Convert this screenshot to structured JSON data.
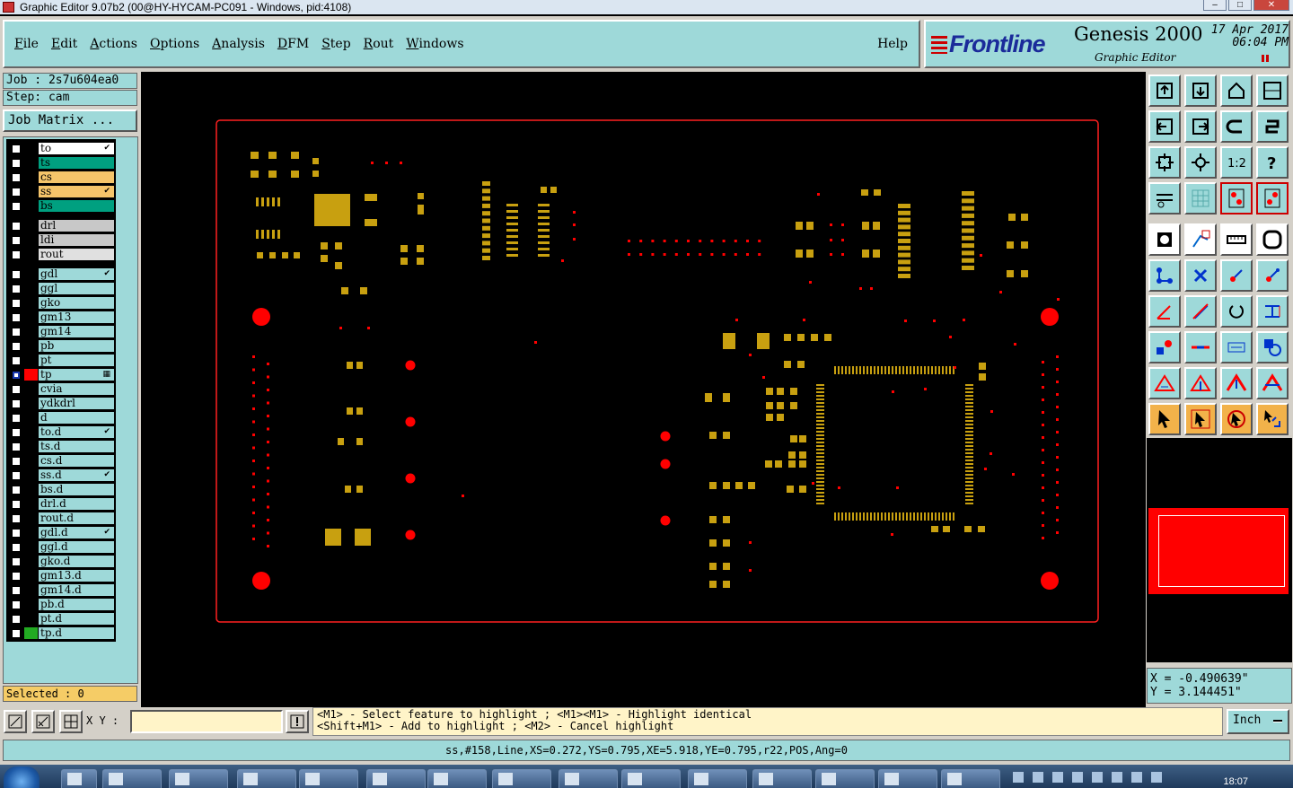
{
  "title": "Graphic Editor 9.07b2 (00@HY-HYCAM-PC091 - Windows, pid:4108)",
  "menu": [
    "File",
    "Edit",
    "Actions",
    "Options",
    "Analysis",
    "DFM",
    "Step",
    "Rout",
    "Windows"
  ],
  "help": "Help",
  "brand": {
    "logo": "Frontline",
    "product": "Genesis 2000",
    "subtitle": "Graphic Editor",
    "date": "17 Apr 2017",
    "time": "06:04 PM"
  },
  "job": {
    "job": "Job : 2s7u604ea0",
    "step": "Step: cam",
    "matrix": "Job Matrix ..."
  },
  "layers": [
    {
      "name": "to",
      "color": "#ffffff",
      "mark": "✔"
    },
    {
      "name": "ts",
      "color": "#00a080",
      "mark": ""
    },
    {
      "name": "cs",
      "color": "#f5c46a",
      "mark": ""
    },
    {
      "name": "ss",
      "color": "#f5c46a",
      "mark": "✔"
    },
    {
      "name": "bs",
      "color": "#00a080",
      "mark": ""
    },
    {
      "name": "drl",
      "color": "#c8c8c8",
      "mark": ""
    },
    {
      "name": "ldi",
      "color": "#c8c8c8",
      "mark": ""
    },
    {
      "name": "rout",
      "color": "#e0e0e0",
      "mark": ""
    },
    {
      "name": "gdl",
      "color": "#9ed9d9",
      "mark": "✔"
    },
    {
      "name": "ggl",
      "color": "#9ed9d9",
      "mark": ""
    },
    {
      "name": "gko",
      "color": "#9ed9d9",
      "mark": ""
    },
    {
      "name": "gm13",
      "color": "#9ed9d9",
      "mark": ""
    },
    {
      "name": "gm14",
      "color": "#9ed9d9",
      "mark": ""
    },
    {
      "name": "pb",
      "color": "#9ed9d9",
      "mark": ""
    },
    {
      "name": "pt",
      "color": "#9ed9d9",
      "mark": ""
    },
    {
      "name": "tp",
      "color": "#9ed9d9",
      "mark": "▦"
    },
    {
      "name": "cvia",
      "color": "#9ed9d9",
      "mark": ""
    },
    {
      "name": "ydkdrl",
      "color": "#9ed9d9",
      "mark": ""
    },
    {
      "name": "d",
      "color": "#9ed9d9",
      "mark": ""
    },
    {
      "name": "to.d",
      "color": "#9ed9d9",
      "mark": "✔"
    },
    {
      "name": "ts.d",
      "color": "#9ed9d9",
      "mark": ""
    },
    {
      "name": "cs.d",
      "color": "#9ed9d9",
      "mark": ""
    },
    {
      "name": "ss.d",
      "color": "#9ed9d9",
      "mark": "✔"
    },
    {
      "name": "bs.d",
      "color": "#9ed9d9",
      "mark": ""
    },
    {
      "name": "drl.d",
      "color": "#9ed9d9",
      "mark": ""
    },
    {
      "name": "rout.d",
      "color": "#9ed9d9",
      "mark": ""
    },
    {
      "name": "gdl.d",
      "color": "#9ed9d9",
      "mark": "✔"
    },
    {
      "name": "ggl.d",
      "color": "#9ed9d9",
      "mark": ""
    },
    {
      "name": "gko.d",
      "color": "#9ed9d9",
      "mark": ""
    },
    {
      "name": "gm13.d",
      "color": "#9ed9d9",
      "mark": ""
    },
    {
      "name": "gm14.d",
      "color": "#9ed9d9",
      "mark": ""
    },
    {
      "name": "pb.d",
      "color": "#9ed9d9",
      "mark": ""
    },
    {
      "name": "pt.d",
      "color": "#9ed9d9",
      "mark": ""
    },
    {
      "name": "tp.d",
      "color": "#9ed9d9",
      "mark": ""
    }
  ],
  "work_layer_colors": {
    "tp": "#ff0000",
    "tp.d": "#22aa22"
  },
  "selected": "Selected : 0",
  "coords": {
    "x": "X = -0.490639\"",
    "y": "Y = 3.144451\""
  },
  "xy_label": "X Y :",
  "xy_value": "",
  "messages": [
    "<M1> - Select feature to highlight ; <M1><M1> - Highlight identical",
    "<Shift+M1> - Add to highlight ; <M2> - Cancel highlight"
  ],
  "units": "Inch",
  "status": "ss,#158,Line,XS=0.272,YS=0.795,XE=5.918,YE=0.795,r22,POS,Ang=0",
  "clock": "18:07",
  "colors": {
    "pad": "#c8a010",
    "drill": "#ff0000",
    "outline": "#ff2020",
    "panel": "#9ed9d9"
  },
  "tools": [
    "save-icon",
    "open-icon",
    "home-icon",
    "window-icon",
    "move-left-icon",
    "move-right-icon",
    "undo-icon",
    "redo-icon",
    "zoom-fit-icon",
    "zoom-center-icon",
    "scale-1to2-icon",
    "help-icon",
    "settings-icon",
    "grid-icon",
    "layers-icon",
    "layers-alt-icon",
    "snap-icon",
    "edit-shape-icon",
    "ruler-icon",
    "circle-icon",
    "connect-icon",
    "cross-icon",
    "point-icon",
    "point-alt-icon",
    "line-icon",
    "diag-line-icon",
    "arc-icon",
    "track-icon",
    "pad-icon",
    "hline-icon",
    "box-icon",
    "route-icon",
    "triangle-icon",
    "triangle-alt-icon",
    "triangle-up-icon",
    "triangle-a-icon",
    "pointer-icon",
    "select-icon",
    "select-alt-icon",
    "pointer-step-icon"
  ]
}
